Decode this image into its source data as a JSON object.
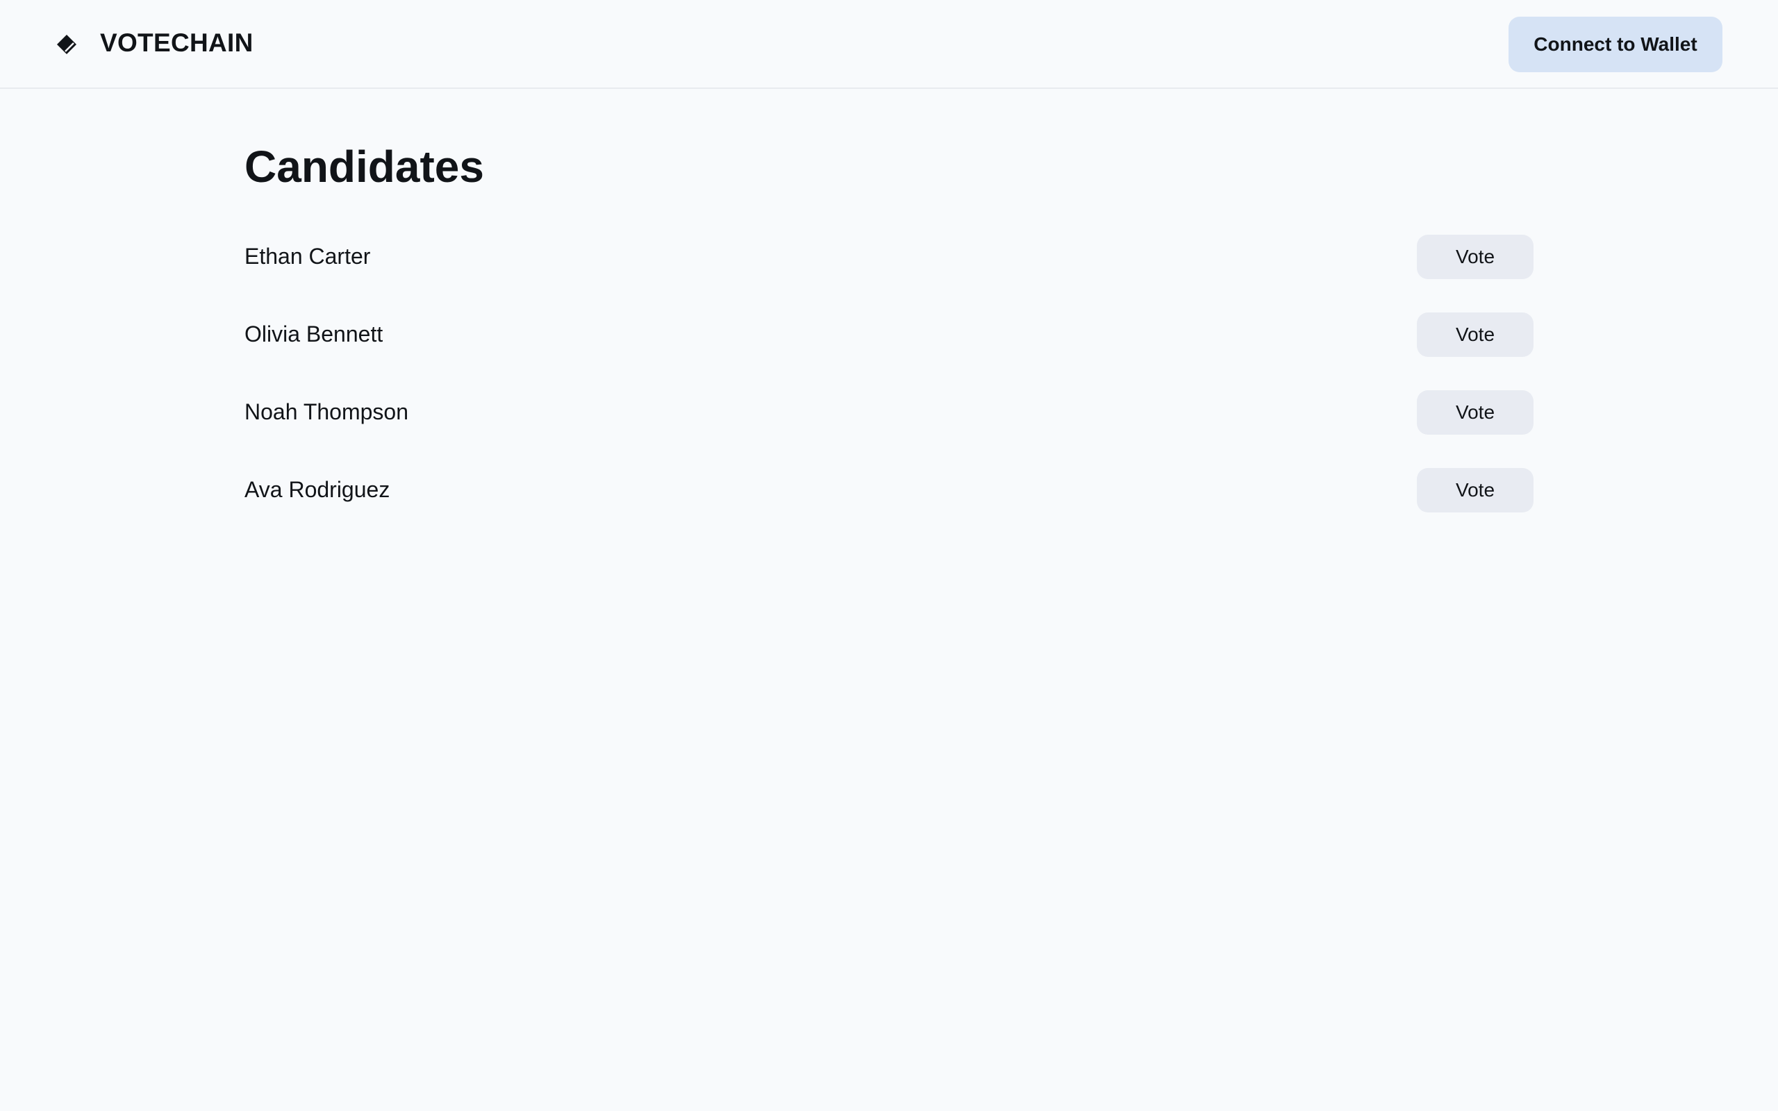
{
  "header": {
    "logo_icon": "ticket-icon",
    "brand": "VOTECHAIN",
    "connect_label": "Connect to Wallet"
  },
  "main": {
    "title": "Candidates",
    "vote_label": "Vote",
    "candidates": [
      {
        "name": "Ethan Carter"
      },
      {
        "name": "Olivia Bennett"
      },
      {
        "name": "Noah Thompson"
      },
      {
        "name": "Ava Rodriguez"
      }
    ]
  },
  "colors": {
    "background": "#f8fafc",
    "connect_button": "#d6e3f5",
    "vote_button": "#e8ebf2",
    "text": "#111418"
  }
}
